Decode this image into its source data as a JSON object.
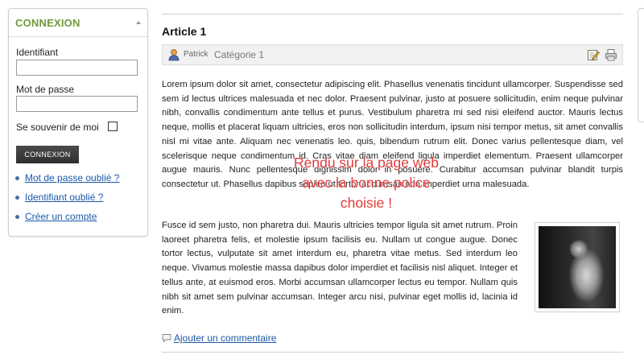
{
  "login": {
    "title": "CONNEXION",
    "username_label": "Identifiant",
    "username_value": "",
    "password_label": "Mot de passe",
    "password_value": "",
    "remember_label": "Se souvenir de moi",
    "button_label": "CONNEXION",
    "links": [
      "Mot de passe oublié ?",
      "Identifiant oublié ?",
      "Créer un compte"
    ]
  },
  "article": {
    "title": "Article 1",
    "author": "Patrick",
    "category": "Catégorie 1",
    "paragraph1": "Lorem ipsum dolor sit amet, consectetur adipiscing elit. Phasellus venenatis tincidunt ullamcorper. Suspendisse sed sem id lectus ultrices malesuada et nec dolor. Praesent pulvinar, justo at posuere sollicitudin, enim neque pulvinar nibh, convallis condimentum ante tellus et purus. Vestibulum pharetra mi sed nisi eleifend auctor. Mauris lectus neque, mollis et placerat liquam ultricies, eros non sollicitudin interdum, ipsum nisi tempor metus, sit amet convallis nisl mi vitae ante. Aliquam nec venenatis leo. quis, bibendum rutrum elit. Donec varius pellentesque diam, vel scelerisque neque condimentum id. Cras vitae diam eleifend ligula imperdiet elementum. Praesent ullamcorper augue mauris. Nunc pellentesque dignissim dolor in posuere. Curabitur accumsan pulvinar blandit turpis consectetur ut. Phasellus dapibus sapien ut tortor accumsan non imperdiet urna malesuada.",
    "paragraph2": "Fusce id sem justo, non pharetra dui. Mauris ultricies tempor ligula sit amet rutrum. Proin laoreet pharetra felis, et molestie ipsum facilisis eu. Nullam ut congue augue. Donec tortor lectus, vulputate sit amet interdum eu, pharetra vitae metus. Sed interdum leo neque. Vivamus molestie massa dapibus dolor imperdiet et facilisis nisl aliquet. Integer et tellus ante, at euismod eros. Morbi accumsan ullamcorper lectus eu tempor. Nullam quis nibh sit amet sem pulvinar accumsan. Integer arcu nisi, pulvinar eget mollis id, lacinia id enim.",
    "comment_link": "Ajouter un commentaire"
  },
  "overlay": {
    "lines": [
      "Rendu sur la page web",
      "avec la bonne police",
      "choisie !"
    ],
    "color": "#e13a3a"
  },
  "colors": {
    "accent_green": "#6f9b3a",
    "link_blue": "#1b58a8"
  }
}
